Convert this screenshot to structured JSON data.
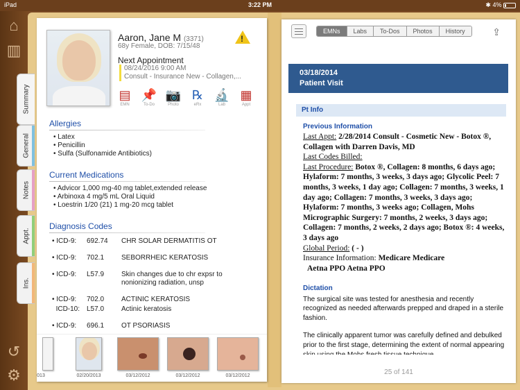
{
  "status_bar": {
    "device": "iPad",
    "time": "3:22 PM",
    "battery": "4%"
  },
  "rail": {
    "top_icons": [
      "home-icon",
      "chart-icon"
    ],
    "bottom_icons": [
      "history-icon",
      "settings-icon"
    ]
  },
  "side_tabs": [
    {
      "label": "Summary",
      "color": "#f0f0f0"
    },
    {
      "label": "General",
      "color": "#7fc0df"
    },
    {
      "label": "Notes",
      "color": "#e6a0c5"
    },
    {
      "label": "Appt.",
      "color": "#91cf7b"
    },
    {
      "label": "Ins.",
      "color": "#f2b77a"
    }
  ],
  "patient": {
    "name": "Aaron, Jane M",
    "id": "(3371)",
    "sub": "68y Female, DOB: 7/15/48",
    "next_label": "Next Appointment",
    "next_date": "08/24/2016 9:00 AM",
    "next_desc": "Consult - Insurance New - Collagen,..."
  },
  "actions": [
    {
      "label": "EMN",
      "icon": "document-icon",
      "glyph": "▤",
      "color": "#c0302a"
    },
    {
      "label": "To-Do",
      "icon": "pin-icon",
      "glyph": "📌",
      "color": "#e8a62a"
    },
    {
      "label": "Photo",
      "icon": "camera-icon",
      "glyph": "📷",
      "color": "#5aa84b"
    },
    {
      "label": "eRx",
      "icon": "rx-icon",
      "glyph": "℞",
      "color": "#2a63b7"
    },
    {
      "label": "Lab",
      "icon": "microscope-icon",
      "glyph": "🔬",
      "color": "#2a63b7"
    },
    {
      "label": "Appt",
      "icon": "calendar-icon",
      "glyph": "▦",
      "color": "#c0302a"
    }
  ],
  "allergies": {
    "title": "Allergies",
    "items": [
      "Latex",
      "Penicillin",
      "Sulfa (Sulfonamide Antibiotics)"
    ]
  },
  "medications": {
    "title": "Current Medications",
    "items": [
      "Advicor 1,000 mg-40 mg tablet,extended release",
      "Arbinoxa 4 mg/5 mL Oral Liquid",
      "Loestrin 1/20 (21) 1 mg-20 mcg tablet"
    ]
  },
  "diagnosis": {
    "title": "Diagnosis Codes",
    "rows": [
      {
        "system": "ICD-9:",
        "code": "692.74",
        "desc": "CHR SOLAR DERMATITIS OT"
      },
      {
        "system": "ICD-9:",
        "code": "702.1",
        "desc": "SEBORRHEIC KERATOSIS"
      },
      {
        "system": "ICD-9:",
        "code": "L57.9",
        "desc": "Skin changes due to chr expsr to nonionizing radiation, unsp"
      },
      {
        "system": "ICD-9:",
        "code": "702.0",
        "desc": "ACTINIC KERATOSIS"
      },
      {
        "system": "ICD-10:",
        "code": "L57.0",
        "desc": "Actinic keratosis"
      },
      {
        "system": "ICD-9:",
        "code": "696.1",
        "desc": "OT PSORIASIS"
      }
    ]
  },
  "thumbnails": [
    {
      "date": "013"
    },
    {
      "date": "02/20/2013"
    },
    {
      "date": "03/12/2012"
    },
    {
      "date": "03/12/2012"
    },
    {
      "date": "03/12/2012"
    }
  ],
  "right": {
    "tabs": [
      "EMNs",
      "Labs",
      "To-Dos",
      "Photos",
      "History"
    ],
    "active_tab": "EMNs",
    "visit_date": "03/18/2014",
    "visit_type": "Patient Visit",
    "pt_info": "Pt Info",
    "prev_title": "Previous Information",
    "last_appt_label": "Last Appt:",
    "last_appt": "2/28/2014 Consult - Cosmetic New - Botox ®, Collagen with Darren Davis, MD",
    "last_codes_label": "Last Codes Billed:",
    "last_proc_label": "Last Procedure:",
    "last_proc": "Botox ®, Collagen: 8 months, 6 days ago; Hylaform: 7 months, 3 weeks, 3 days ago; Glycolic Peel: 7 months, 3 weeks, 1 day ago; Collagen: 7 months, 3 weeks, 1 day ago; Collagen: 7 months, 3 weeks, 3 days ago; Hylaform: 7 months, 3 weeks ago; Collagen, Mohs Micrographic Surgery: 7 months, 2 weeks, 3 days ago; Collagen: 7 months, 2 weeks, 2 days ago; Botox ®: 4 weeks, 3 days ago",
    "global_label": "Global Period:",
    "global_value": "( - )",
    "ins_label": "Insurance Information:",
    "ins_value": "Medicare  Medicare",
    "ins_value2": "Aetna PPO Aetna PPO",
    "dict_title": "Dictation",
    "dict_p1": "The surgical site was tested for anesthesia and recently recognized as needed afterwards prepped and draped in a sterile fashion.",
    "dict_p2": "The clinically apparent tumor was carefully defined and debulked prior to the first stage, determining the extent of normal appearing skin using the Mohs fresh tissue technique",
    "pager": "25 of 141"
  }
}
